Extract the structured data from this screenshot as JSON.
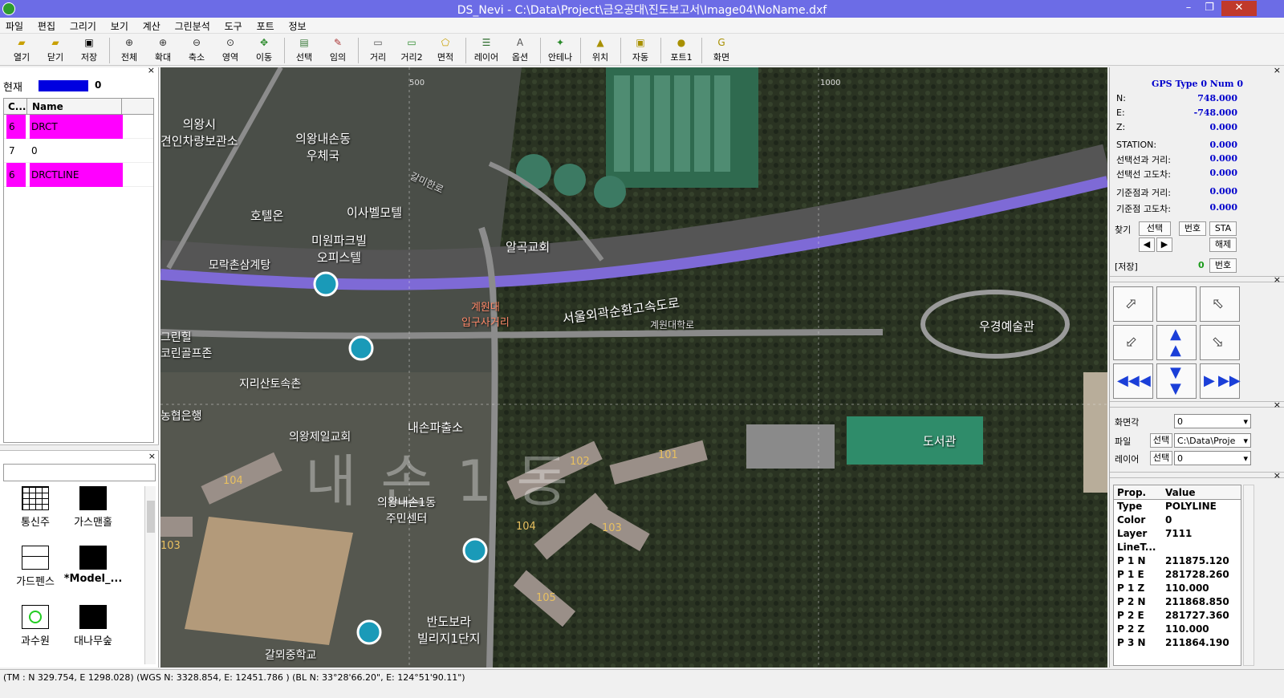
{
  "window": {
    "title": "DS_Nevi - C:\\Data\\Project\\금오공대\\진도보고서\\Image04\\NoName.dxf"
  },
  "menu": [
    "파일",
    "편집",
    "그리기",
    "보기",
    "계산",
    "그린분석",
    "도구",
    "포트",
    "정보"
  ],
  "toolbar": {
    "buttons": [
      "열기",
      "닫기",
      "저장",
      "전체",
      "확대",
      "축소",
      "영역",
      "이동",
      "선택",
      "임의",
      "거리",
      "거리2",
      "면적",
      "레이어",
      "옵션",
      "안테나",
      "위치",
      "자동",
      "포트1",
      "화면"
    ]
  },
  "left": {
    "current_label": "현재",
    "current_value": "0",
    "columns": [
      "C...",
      "Name"
    ],
    "layers": [
      {
        "c": "6",
        "name": "DRCT"
      },
      {
        "c": "7",
        "name": "0"
      },
      {
        "c": "6",
        "name": "DRCTLINE"
      }
    ],
    "highlight_color": "#ff00ff",
    "symbols": [
      "통신주",
      "가스맨홀",
      "가드펜스",
      "*Model_...",
      "과수원",
      "대나무숲"
    ]
  },
  "map": {
    "grid_labels": [
      "500",
      "1000"
    ],
    "road_name": "서울외곽순환고속도로",
    "labels": [
      "의왕시\n견인차량보관소",
      "의왕내손동\n우체국",
      "호텔온",
      "이사벨모텔",
      "미원파크빌\n오피스텔",
      "모락촌삼계탕",
      "알곡교회",
      "계원대\n입구사거리",
      "계원대학로",
      "우경예술관",
      "그린힐\n코린골프존",
      "지리산토속촌",
      "농협은행",
      "의왕제일교회",
      "내손파출소",
      "도서관",
      "의왕내손1동\n주민센터",
      "반도보라\n빌리지1단지",
      "갈뫼중학교",
      "갈미한로",
      "내손1동",
      "102",
      "101",
      "104",
      "103",
      "104",
      "103",
      "105"
    ]
  },
  "gps": {
    "header": "GPS Type 0  Num 0",
    "rows": [
      {
        "k": "N:",
        "v": "748.000"
      },
      {
        "k": "E:",
        "v": "-748.000"
      },
      {
        "k": "Z:",
        "v": "0.000"
      },
      {
        "k": "STATION:",
        "v": "0.000"
      },
      {
        "k": "선택선과 거리:",
        "v": "0.000"
      },
      {
        "k": "선택선 고도차:",
        "v": "0.000"
      },
      {
        "k": "기준점과 거리:",
        "v": "0.000"
      },
      {
        "k": "기준점 고도차:",
        "v": "0.000"
      }
    ],
    "find_label": "찾기",
    "select_btn": "선택",
    "number_btn": "번호",
    "sta_btn": "STA",
    "release_btn": "해제",
    "save_label": "[저장]",
    "save_value": "0",
    "save_number": "번호"
  },
  "props": {
    "angle_label": "화면각",
    "angle_value": "0",
    "file_label": "파일",
    "file_btn": "선택",
    "file_value": "C:\\Data\\Proje",
    "layer_label": "레이어",
    "layer_btn": "선택",
    "layer_value": "0",
    "columns": [
      "Prop.",
      "Value"
    ],
    "rows": [
      {
        "p": "Type",
        "v": "POLYLINE"
      },
      {
        "p": "Color",
        "v": "0"
      },
      {
        "p": "Layer",
        "v": "7111"
      },
      {
        "p": "LineT...",
        "v": ""
      },
      {
        "p": "P 1 N",
        "v": "211875.120"
      },
      {
        "p": "P 1 E",
        "v": "281728.260"
      },
      {
        "p": "P 1 Z",
        "v": "110.000"
      },
      {
        "p": "P 2 N",
        "v": "211868.850"
      },
      {
        "p": "P 2 E",
        "v": "281727.360"
      },
      {
        "p": "P 2 Z",
        "v": "110.000"
      },
      {
        "p": "P 3 N",
        "v": "211864.190"
      }
    ]
  },
  "status": "(TM : N 329.754, E 1298.028)  (WGS N: 3328.854, E: 12451.786 )   (BL N: 33°28'66.20\", E: 124°51'90.11\")"
}
